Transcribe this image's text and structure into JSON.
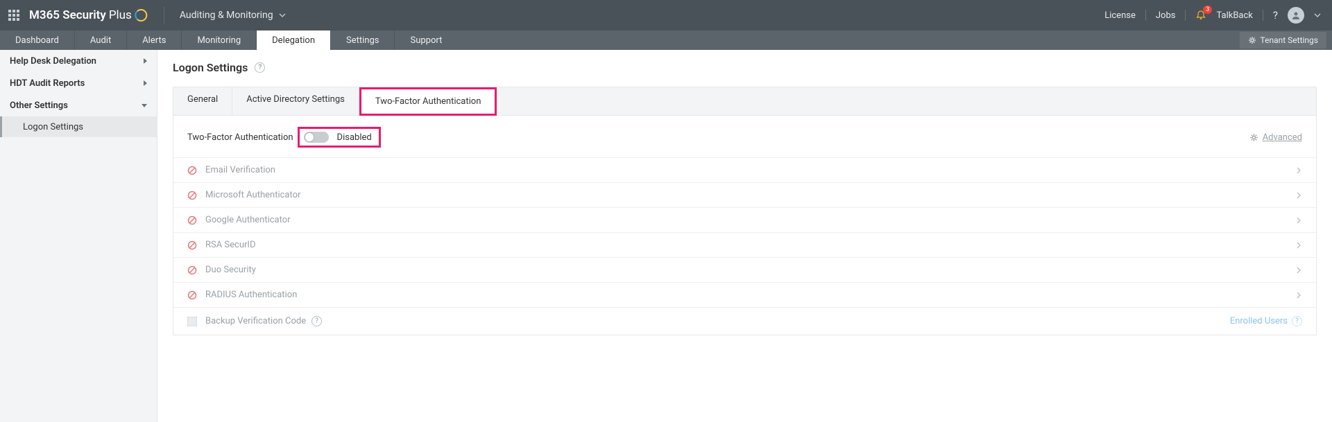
{
  "header": {
    "brand_prefix": "M365 Security",
    "brand_suffix": "Plus",
    "section_dropdown": "Auditing & Monitoring",
    "links": {
      "license": "License",
      "jobs": "Jobs",
      "talkback": "TalkBack"
    },
    "notification_count": "3"
  },
  "tabs": {
    "items": [
      "Dashboard",
      "Audit",
      "Alerts",
      "Monitoring",
      "Delegation",
      "Settings",
      "Support"
    ],
    "active_index": 4,
    "tenant_settings": "Tenant Settings"
  },
  "sidebar": {
    "items": [
      {
        "label": "Help Desk Delegation",
        "expand": "right"
      },
      {
        "label": "HDT Audit Reports",
        "expand": "right"
      },
      {
        "label": "Other Settings",
        "expand": "down"
      }
    ],
    "sub_active": "Logon Settings"
  },
  "page": {
    "title": "Logon Settings",
    "subtabs": [
      "General",
      "Active Directory Settings",
      "Two-Factor Authentication"
    ],
    "active_subtab_index": 2,
    "tfa_label": "Two-Factor Authentication",
    "tfa_state": "Disabled",
    "advanced": "Advanced",
    "methods": [
      "Email Verification",
      "Microsoft Authenticator",
      "Google Authenticator",
      "RSA SecurID",
      "Duo Security",
      "RADIUS Authentication"
    ],
    "backup_label": "Backup Verification Code",
    "enrolled_users": "Enrolled Users"
  }
}
